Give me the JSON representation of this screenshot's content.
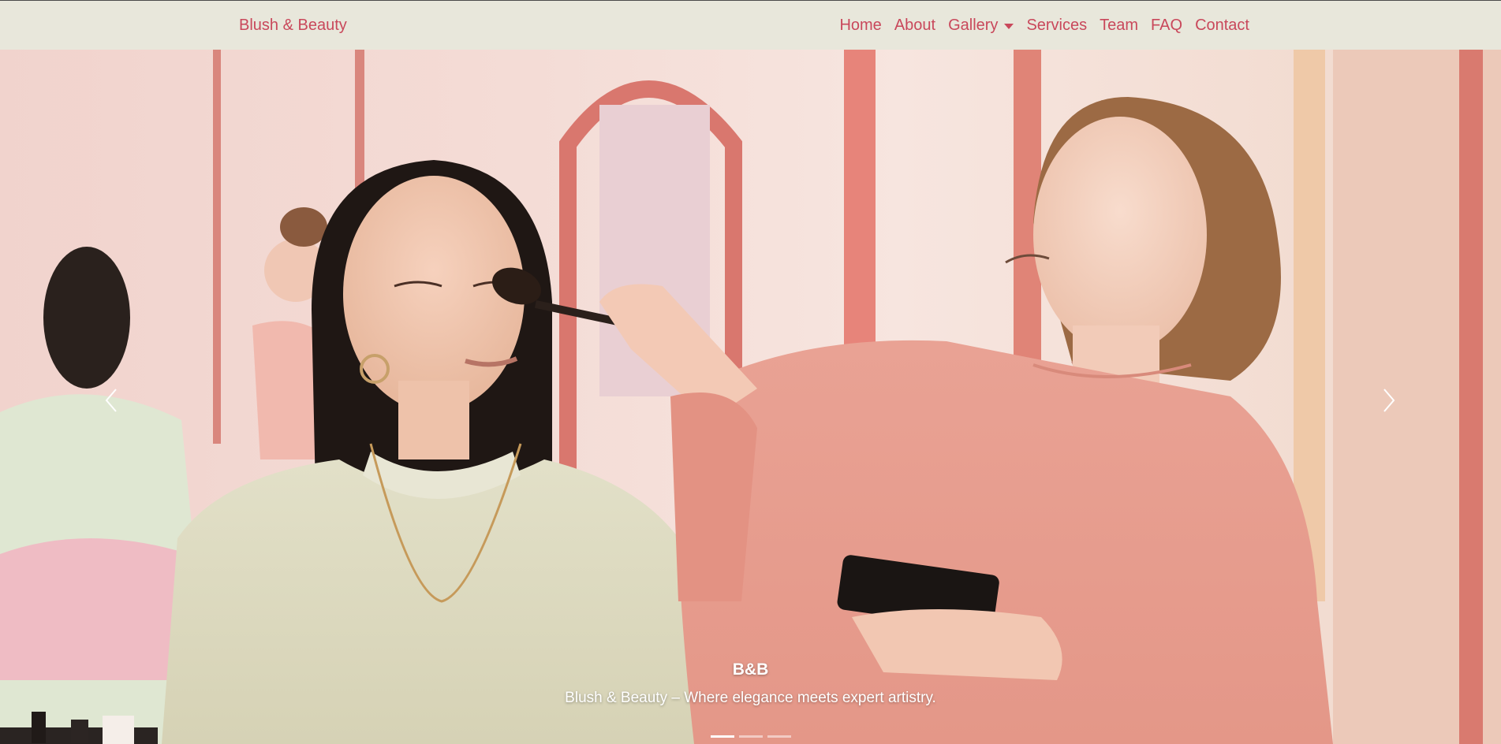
{
  "navbar": {
    "brand": "Blush & Beauty",
    "links": [
      {
        "label": "Home"
      },
      {
        "label": "About"
      },
      {
        "label": "Gallery"
      },
      {
        "label": "Services"
      },
      {
        "label": "Team"
      },
      {
        "label": "FAQ"
      },
      {
        "label": "Contact"
      }
    ]
  },
  "carousel": {
    "caption_title": "B&B",
    "caption_text": "Blush & Beauty – Where elegance meets expert artistry.",
    "active_slide": 1,
    "slide_count": 3,
    "prev_icon": "chevron-left-icon",
    "next_icon": "chevron-right-icon"
  },
  "colors": {
    "navbar_bg": "#e8e7db",
    "accent": "#c9485b"
  }
}
